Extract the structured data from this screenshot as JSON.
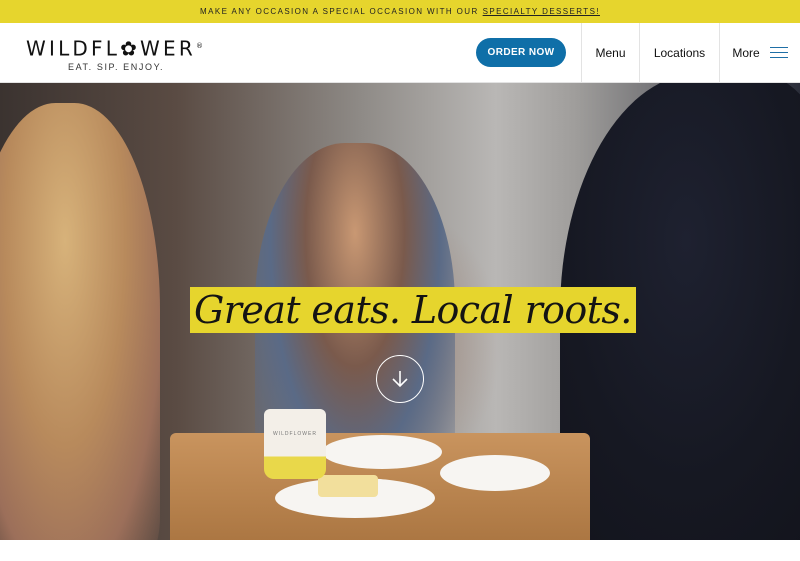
{
  "announcement": {
    "text": "MAKE ANY OCCASION A SPECIAL OCCASION WITH OUR",
    "link": "SPECIALTY DESSERTS!"
  },
  "brand": {
    "name": "WILDFL✿WER",
    "registered": "®",
    "tagline": "EAT. SIP. ENJOY."
  },
  "header": {
    "order_button": "ORDER NOW",
    "nav": {
      "menu": "Menu",
      "locations": "Locations",
      "more": "More"
    }
  },
  "hero": {
    "headline": "Great eats. Local roots.",
    "cup_text": "WILDFLOWER",
    "scroll_icon": "arrow-down-icon"
  },
  "colors": {
    "accent_yellow": "#e6d52d",
    "button_blue": "#0f6fa8",
    "hamburger_blue": "#1f6fa6"
  }
}
